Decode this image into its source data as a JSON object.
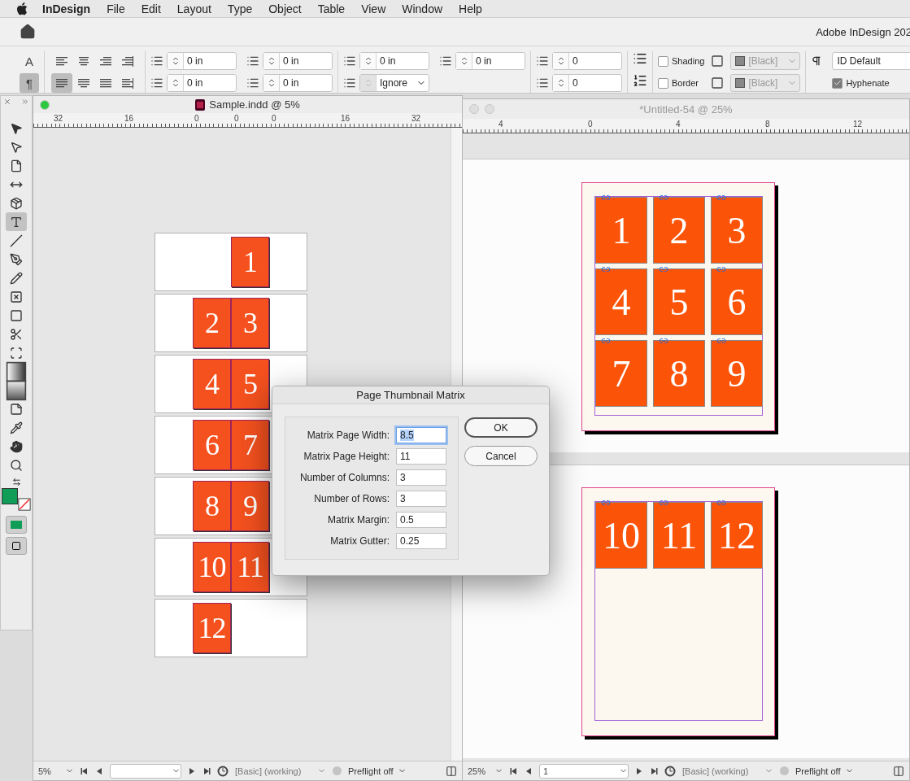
{
  "menu_bar": {
    "app_name": "InDesign",
    "items": [
      "File",
      "Edit",
      "Layout",
      "Type",
      "Object",
      "Table",
      "View",
      "Window",
      "Help"
    ]
  },
  "app_title": "Adobe InDesign 202",
  "control_panel": {
    "modes": [
      {
        "glyph": "A",
        "selected": false
      },
      {
        "glyph": "¶",
        "selected": true
      }
    ],
    "alignments": [
      {
        "kind": "left",
        "selected": false
      },
      {
        "kind": "center",
        "selected": false
      },
      {
        "kind": "right",
        "selected": false
      },
      {
        "kind": "spine",
        "selected": false
      },
      {
        "kind": "justify-left",
        "selected": true
      },
      {
        "kind": "justify-center",
        "selected": false
      },
      {
        "kind": "justify-all",
        "selected": false
      },
      {
        "kind": "away-spine",
        "selected": false
      }
    ],
    "left_indent": "0 in",
    "first_line_indent": "0 in",
    "right_indent": "0 in",
    "last_line_indent": "0 in",
    "space_before": "0 in",
    "align_to_grid": "Ignore",
    "space_after": "0 in",
    "drop_cap_lines": "0",
    "drop_cap_characters": "0",
    "shading": {
      "label": "Shading",
      "checked": false,
      "swatch": "[Black]"
    },
    "border": {
      "label": "Border",
      "checked": false,
      "swatch": "[Black]"
    },
    "paragraph_style": "ID Default",
    "hyphenate": {
      "label": "Hyphenate",
      "checked": true
    }
  },
  "tools": [
    {
      "kind": "selection",
      "selected": false
    },
    {
      "kind": "direct-selection",
      "selected": false
    },
    {
      "kind": "page",
      "selected": false
    },
    {
      "kind": "gap",
      "selected": false
    },
    {
      "kind": "content-collector",
      "selected": false
    },
    {
      "kind": "type",
      "selected": true
    },
    {
      "kind": "line",
      "selected": false
    },
    {
      "kind": "pen",
      "selected": false
    },
    {
      "kind": "pencil",
      "selected": false
    },
    {
      "kind": "rectangle-frame",
      "selected": false
    },
    {
      "kind": "rectangle",
      "selected": false
    },
    {
      "kind": "scissors",
      "selected": false
    },
    {
      "kind": "free-transform",
      "selected": false
    },
    {
      "kind": "gradient-swatch",
      "selected": false
    },
    {
      "kind": "gradient-feather",
      "selected": false
    },
    {
      "kind": "note",
      "selected": false
    },
    {
      "kind": "eyedropper",
      "selected": false
    },
    {
      "kind": "hand",
      "selected": false
    },
    {
      "kind": "zoom",
      "selected": false
    }
  ],
  "fill": {
    "color": "#0f9d58"
  },
  "left_window": {
    "title": "Sample.indd @ 5%",
    "ruler": [
      "32",
      "16",
      "0",
      "0",
      "0",
      "16",
      "32"
    ],
    "spreads": [
      {
        "kind": "right-page",
        "pages": [
          "1"
        ]
      },
      {
        "kind": "facing",
        "pages": [
          "2",
          "3"
        ]
      },
      {
        "kind": "facing",
        "pages": [
          "4",
          "5"
        ]
      },
      {
        "kind": "facing",
        "pages": [
          "6",
          "7"
        ]
      },
      {
        "kind": "facing",
        "pages": [
          "8",
          "9"
        ]
      },
      {
        "kind": "facing",
        "pages": [
          "10",
          "11"
        ]
      },
      {
        "kind": "left-page",
        "pages": [
          "12"
        ]
      }
    ],
    "status": {
      "zoom": "5%",
      "profile": "[Basic] (working)",
      "preflight": "Preflight off"
    }
  },
  "right_window": {
    "title": "*Untitled-54 @ 25%",
    "ruler": [
      "4",
      "0",
      "4",
      "8",
      "12"
    ],
    "pages": [
      {
        "cells": [
          "1",
          "2",
          "3",
          "4",
          "5",
          "6",
          "7",
          "8",
          "9"
        ]
      },
      {
        "cells": [
          "10",
          "11",
          "12"
        ]
      }
    ],
    "status": {
      "zoom": "25%",
      "page": "1",
      "profile": "[Basic] (working)",
      "preflight": "Preflight off"
    }
  },
  "dialog": {
    "title": "Page Thumbnail Matrix",
    "fields": [
      {
        "label": "Matrix Page Width:",
        "value": "8.5",
        "selected": true
      },
      {
        "label": "Matrix Page Height:",
        "value": "11",
        "selected": false
      },
      {
        "label": "Number of Columns:",
        "value": "3",
        "selected": false
      },
      {
        "label": "Number of Rows:",
        "value": "3",
        "selected": false
      },
      {
        "label": "Matrix Margin:",
        "value": "0.5",
        "selected": false
      },
      {
        "label": "Matrix Gutter:",
        "value": "0.25",
        "selected": false
      }
    ],
    "buttons": [
      {
        "label": "OK",
        "kind": "default"
      },
      {
        "label": "Cancel",
        "kind": "normal"
      }
    ]
  }
}
